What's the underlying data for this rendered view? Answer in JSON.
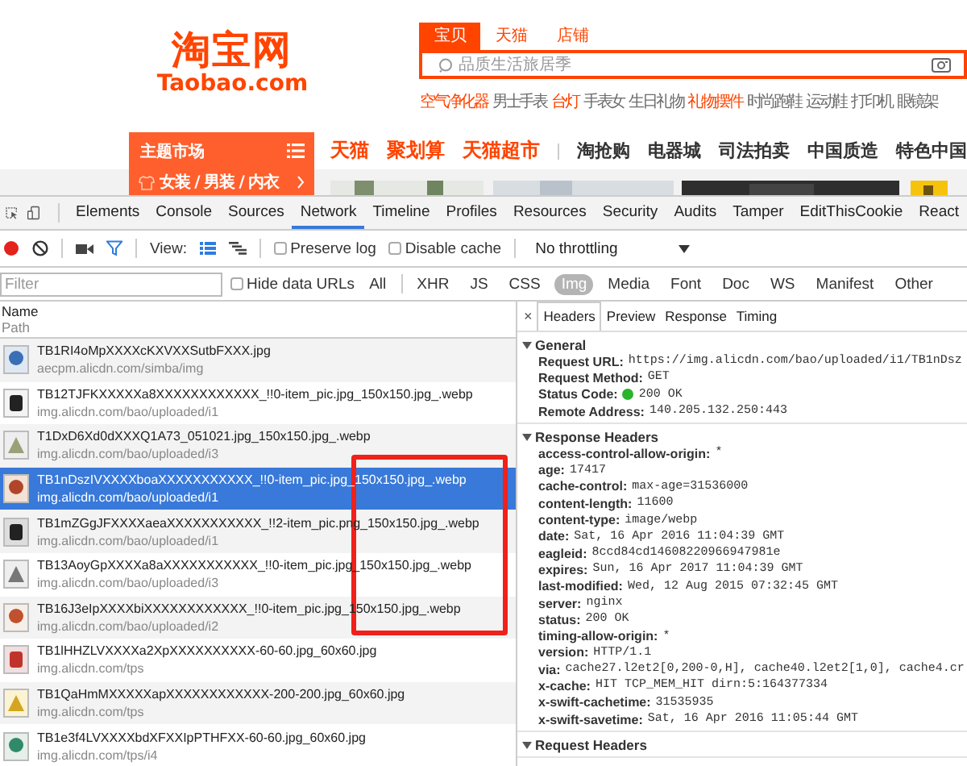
{
  "site": {
    "logo": {
      "name": "淘宝网",
      "domain": "Taobao.com"
    },
    "search_tabs": [
      {
        "label": "宝贝",
        "selected": true
      },
      {
        "label": "天猫",
        "selected": false
      },
      {
        "label": "店铺",
        "selected": false
      }
    ],
    "search": {
      "placeholder": "品质生活旅居季"
    },
    "hot_words": [
      {
        "text": "空气净化器",
        "highlighted": true
      },
      {
        "text": "男士手表",
        "highlighted": false
      },
      {
        "text": "台灯",
        "highlighted": true
      },
      {
        "text": "手表女",
        "highlighted": false
      },
      {
        "text": "生日礼物",
        "highlighted": false
      },
      {
        "text": "礼物摆件",
        "highlighted": true
      },
      {
        "text": "时尚跑鞋",
        "highlighted": false
      },
      {
        "text": "运动鞋",
        "highlighted": false
      },
      {
        "text": "打印机",
        "highlighted": false
      },
      {
        "text": "眼镜架",
        "highlighted": false
      }
    ],
    "category_menu": {
      "title": "主题市场",
      "items": [
        "女装 / 男装 / 内衣"
      ]
    },
    "nav": [
      {
        "label": "天猫",
        "featured": true
      },
      {
        "label": "聚划算",
        "featured": true
      },
      {
        "label": "天猫超市",
        "featured": true
      },
      {
        "label": "淘抢购",
        "featured": false
      },
      {
        "label": "电器城",
        "featured": false
      },
      {
        "label": "司法拍卖",
        "featured": false
      },
      {
        "label": "中国质造",
        "featured": false
      },
      {
        "label": "特色中国",
        "featured": false
      }
    ]
  },
  "devtools": {
    "tabs": [
      {
        "label": "Elements",
        "selected": false
      },
      {
        "label": "Console",
        "selected": false
      },
      {
        "label": "Sources",
        "selected": false
      },
      {
        "label": "Network",
        "selected": true
      },
      {
        "label": "Timeline",
        "selected": false
      },
      {
        "label": "Profiles",
        "selected": false
      },
      {
        "label": "Resources",
        "selected": false
      },
      {
        "label": "Security",
        "selected": false
      },
      {
        "label": "Audits",
        "selected": false
      },
      {
        "label": "Tamper",
        "selected": false
      },
      {
        "label": "EditThisCookie",
        "selected": false
      },
      {
        "label": "React",
        "selected": false
      }
    ],
    "toolbar": {
      "recording": true,
      "view_label": "View:",
      "preserve_log": {
        "label": "Preserve log",
        "checked": false
      },
      "disable_cache": {
        "label": "Disable cache",
        "checked": false
      },
      "throttling": "No throttling"
    },
    "filter": {
      "placeholder": "Filter",
      "hide_data_urls": {
        "label": "Hide data URLs",
        "checked": false
      },
      "types": [
        {
          "label": "All",
          "selected": false
        },
        {
          "label": "XHR",
          "selected": false
        },
        {
          "label": "JS",
          "selected": false
        },
        {
          "label": "CSS",
          "selected": false
        },
        {
          "label": "Img",
          "selected": true
        },
        {
          "label": "Media",
          "selected": false
        },
        {
          "label": "Font",
          "selected": false
        },
        {
          "label": "Doc",
          "selected": false
        },
        {
          "label": "WS",
          "selected": false
        },
        {
          "label": "Manifest",
          "selected": false
        },
        {
          "label": "Other",
          "selected": false
        }
      ]
    },
    "requests": {
      "columns": [
        "Name",
        "Path"
      ],
      "rows": [
        {
          "name": "TB1RI4oMpXXXXcKXVXXSutbFXXX.jpg",
          "path": "aecpm.alicdn.com/simba/img",
          "selected": false
        },
        {
          "name": "TB12TJFKXXXXXa8XXXXXXXXXXXX_!!0-item_pic.jpg_150x150.jpg_.webp",
          "path": "img.alicdn.com/bao/uploaded/i1",
          "selected": false
        },
        {
          "name": "T1DxD6Xd0dXXXQ1A73_051021.jpg_150x150.jpg_.webp",
          "path": "img.alicdn.com/bao/uploaded/i3",
          "selected": false
        },
        {
          "name": "TB1nDszIVXXXXboaXXXXXXXXXXX_!!0-item_pic.jpg_150x150.jpg_.webp",
          "path": "img.alicdn.com/bao/uploaded/i1",
          "selected": true
        },
        {
          "name": "TB1mZGgJFXXXXaeaXXXXXXXXXXX_!!2-item_pic.png_150x150.jpg_.webp",
          "path": "img.alicdn.com/bao/uploaded/i1",
          "selected": false
        },
        {
          "name": "TB13AoyGpXXXXa8aXXXXXXXXXXX_!!0-item_pic.jpg_150x150.jpg_.webp",
          "path": "img.alicdn.com/bao/uploaded/i3",
          "selected": false
        },
        {
          "name": "TB16J3eIpXXXXbiXXXXXXXXXXXX_!!0-item_pic.jpg_150x150.jpg_.webp",
          "path": "img.alicdn.com/bao/uploaded/i2",
          "selected": false
        },
        {
          "name": "TB1lHHZLVXXXXa2XpXXXXXXXXXX-60-60.jpg_60x60.jpg",
          "path": "img.alicdn.com/tps",
          "selected": false
        },
        {
          "name": "TB1QaHmMXXXXXapXXXXXXXXXXXX-200-200.jpg_60x60.jpg",
          "path": "img.alicdn.com/tps",
          "selected": false
        },
        {
          "name": "TB1e3f4LVXXXXbdXFXXIpPTHFXX-60-60.jpg_60x60.jpg",
          "path": "img.alicdn.com/tps/i4",
          "selected": false
        }
      ]
    },
    "detail": {
      "close": "×",
      "tabs": [
        {
          "label": "Headers",
          "selected": true
        },
        {
          "label": "Preview",
          "selected": false
        },
        {
          "label": "Response",
          "selected": false
        },
        {
          "label": "Timing",
          "selected": false
        }
      ],
      "sections": [
        {
          "title": "General",
          "expanded": true,
          "items": [
            {
              "key": "Request URL:",
              "value": "https://img.alicdn.com/bao/uploaded/i1/TB1nDsz"
            },
            {
              "key": "Request Method:",
              "value": "GET"
            },
            {
              "key": "Status Code:",
              "value": "200 OK",
              "kind": "status"
            },
            {
              "key": "Remote Address:",
              "value": "140.205.132.250:443"
            }
          ]
        },
        {
          "title": "Response Headers",
          "expanded": true,
          "items": [
            {
              "key": "access-control-allow-origin:",
              "value": "*"
            },
            {
              "key": "age:",
              "value": "17417"
            },
            {
              "key": "cache-control:",
              "value": "max-age=31536000"
            },
            {
              "key": "content-length:",
              "value": "11600"
            },
            {
              "key": "content-type:",
              "value": "image/webp"
            },
            {
              "key": "date:",
              "value": "Sat, 16 Apr 2016 11:04:39 GMT"
            },
            {
              "key": "eagleid:",
              "value": "8ccd84cd14608220966947981e"
            },
            {
              "key": "expires:",
              "value": "Sun, 16 Apr 2017 11:04:39 GMT"
            },
            {
              "key": "last-modified:",
              "value": "Wed, 12 Aug 2015 07:32:45 GMT"
            },
            {
              "key": "server:",
              "value": "nginx"
            },
            {
              "key": "status:",
              "value": "200 OK"
            },
            {
              "key": "timing-allow-origin:",
              "value": "*"
            },
            {
              "key": "version:",
              "value": "HTTP/1.1"
            },
            {
              "key": "via:",
              "value": "cache27.l2et2[0,200-0,H], cache40.l2et2[1,0], cache4.cr"
            },
            {
              "key": "x-cache:",
              "value": "HIT TCP_MEM_HIT dirn:5:164377334"
            },
            {
              "key": "x-swift-cachetime:",
              "value": "31535935"
            },
            {
              "key": "x-swift-savetime:",
              "value": "Sat, 16 Apr 2016 11:05:44 GMT"
            }
          ]
        },
        {
          "title": "Request Headers",
          "expanded": true
        }
      ]
    }
  },
  "annotation": {
    "kind": "highlight-box"
  }
}
